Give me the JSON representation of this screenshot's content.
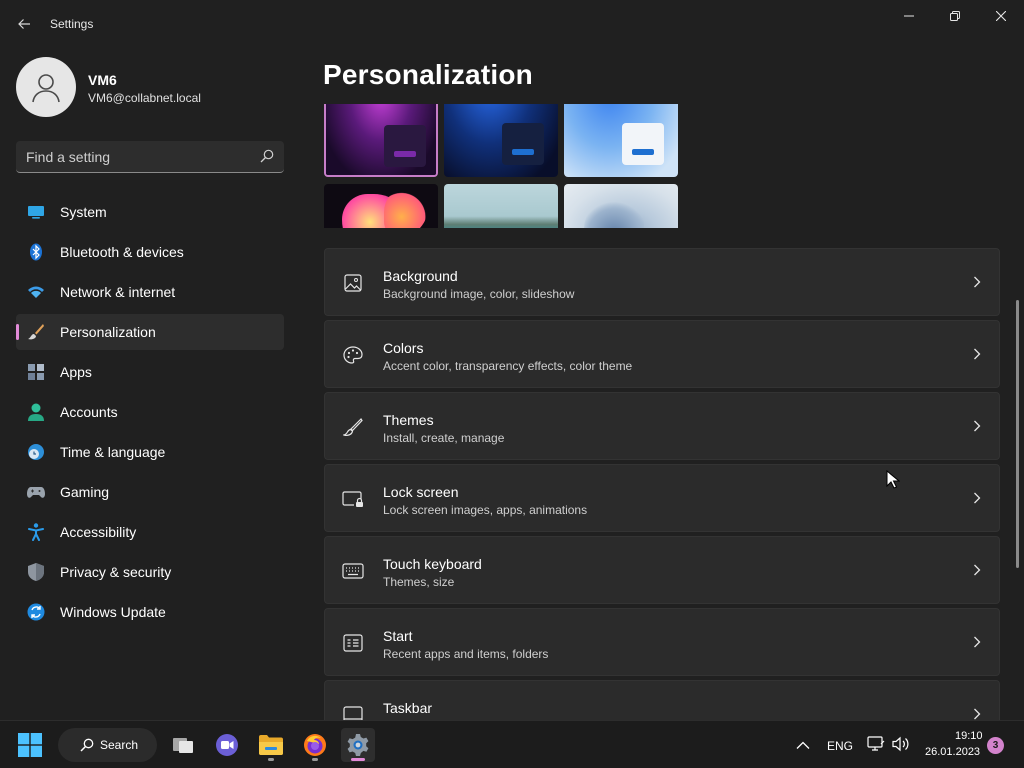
{
  "window": {
    "title": "Settings",
    "controls": [
      "minimize",
      "restore",
      "close"
    ]
  },
  "user": {
    "name": "VM6",
    "email": "VM6@collabnet.local"
  },
  "search": {
    "placeholder": "Find a setting"
  },
  "sidebar": {
    "items": [
      {
        "label": "System",
        "icon": "monitor-icon",
        "active": false
      },
      {
        "label": "Bluetooth & devices",
        "icon": "bluetooth-icon",
        "active": false
      },
      {
        "label": "Network & internet",
        "icon": "wifi-icon",
        "active": false
      },
      {
        "label": "Personalization",
        "icon": "paintbrush-icon",
        "active": true
      },
      {
        "label": "Apps",
        "icon": "apps-icon",
        "active": false
      },
      {
        "label": "Accounts",
        "icon": "person-icon",
        "active": false
      },
      {
        "label": "Time & language",
        "icon": "clock-globe-icon",
        "active": false
      },
      {
        "label": "Gaming",
        "icon": "gamepad-icon",
        "active": false
      },
      {
        "label": "Accessibility",
        "icon": "accessibility-icon",
        "active": false
      },
      {
        "label": "Privacy & security",
        "icon": "shield-icon",
        "active": false
      },
      {
        "label": "Windows Update",
        "icon": "update-icon",
        "active": false
      }
    ]
  },
  "main": {
    "title": "Personalization",
    "theme_thumbnails": [
      {
        "name": "glow-purple",
        "accent": "#7a2aa8"
      },
      {
        "name": "bloom-blue",
        "accent": "#1e6fd0"
      },
      {
        "name": "bloom-light-blue",
        "accent": "#1e6fd0"
      },
      {
        "name": "flowers",
        "accent": "#d11a2a"
      },
      {
        "name": "lake",
        "accent": "#3f9aa8"
      },
      {
        "name": "captured-motion",
        "accent": "#6b7078"
      }
    ],
    "settings": [
      {
        "title": "Background",
        "subtitle": "Background image, color, slideshow",
        "icon": "image-icon"
      },
      {
        "title": "Colors",
        "subtitle": "Accent color, transparency effects, color theme",
        "icon": "palette-icon"
      },
      {
        "title": "Themes",
        "subtitle": "Install, create, manage",
        "icon": "brush-icon"
      },
      {
        "title": "Lock screen",
        "subtitle": "Lock screen images, apps, animations",
        "icon": "lock-screen-icon"
      },
      {
        "title": "Touch keyboard",
        "subtitle": "Themes, size",
        "icon": "keyboard-icon"
      },
      {
        "title": "Start",
        "subtitle": "Recent apps and items, folders",
        "icon": "start-icon"
      },
      {
        "title": "Taskbar",
        "subtitle": "",
        "icon": "taskbar-icon"
      }
    ]
  },
  "taskbar": {
    "search_label": "Search",
    "apps": [
      "task-view-icon",
      "teams-icon",
      "file-explorer-icon",
      "firefox-icon",
      "settings-icon"
    ],
    "language": "ENG",
    "time": "19:10",
    "date": "26.01.2023",
    "notification_count": "3"
  },
  "colors": {
    "accent": "#e28bd8",
    "background": "#202020",
    "card": "#2b2b2b"
  }
}
